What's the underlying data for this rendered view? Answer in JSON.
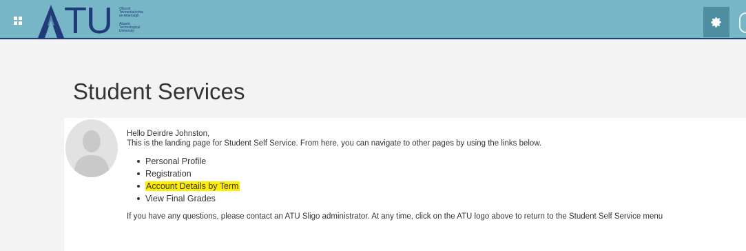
{
  "header": {
    "logo_text": "TU",
    "logo_lines": [
      "Ollscoil",
      "Teicneolaíochta",
      "an Atlantaigh",
      "Atlantic",
      "Technological",
      "University"
    ],
    "brand_color": "#77b6c6",
    "brand_dark": "#1f3b78",
    "icons": {
      "apps": "apps-grid-icon",
      "settings": "gear-icon",
      "user": "user-icon"
    }
  },
  "page": {
    "title": "Student Services"
  },
  "card": {
    "greeting": "Hello Deirdre Johnston,",
    "intro": "This is the landing page for Student Self Service. From here, you can navigate to other pages by using the links below.",
    "links": [
      {
        "label": "Personal Profile",
        "highlighted": false
      },
      {
        "label": "Registration",
        "highlighted": false
      },
      {
        "label": "Account Details by Term",
        "highlighted": true
      },
      {
        "label": "View Final Grades",
        "highlighted": false
      }
    ],
    "footer": "If you have any questions, please contact an ATU Sligo administrator. At any time, click on the ATU logo above to return to the Student Self Service menu"
  },
  "colors": {
    "highlight": "#ffee00",
    "page_bg": "#f3f3f3"
  }
}
